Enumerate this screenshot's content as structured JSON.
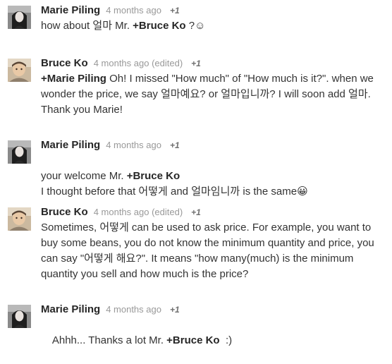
{
  "comments": [
    {
      "author": "Marie Piling",
      "time": "4 months ago",
      "plus": "+1",
      "segments": [
        {
          "text": "how about 얼마 Mr. "
        },
        {
          "text": "+Bruce Ko",
          "mention": true
        },
        {
          "text": " ?☺"
        }
      ]
    },
    {
      "author": "Bruce Ko",
      "time": "4 months ago (edited)",
      "plus": "+1",
      "segments": [
        {
          "text": "+Marie Piling",
          "mention": true
        },
        {
          "text": " Oh! I missed \"How much\" of \"How much is it?\". when we wonder the price, we say 얼마예요? or 얼마입니까? I will soon add 얼마. Thank you Marie!"
        }
      ]
    },
    {
      "author": "Marie Piling",
      "time": "4 months ago",
      "plus": "+1",
      "segments": [
        {
          "text": "your welcome Mr. "
        },
        {
          "text": "+Bruce Ko",
          "mention": true
        },
        {
          "text": "\nI thought before that 어떻게 and 얼마임니까 is the same😀"
        }
      ]
    },
    {
      "author": "Bruce Ko",
      "time": "4 months ago (edited)",
      "plus": "+1",
      "segments": [
        {
          "text": "Sometimes, 어떻게 can be used to ask price. For example, you want to buy some beans, you do not know the minimum quantity and price, you can say \"어떻게 해요?\". It means \"how many(much) is the minimum quantity you sell and how much is the price?"
        }
      ]
    },
    {
      "author": "Marie Piling",
      "time": "4 months ago",
      "plus": "+1",
      "segments": [
        {
          "text": "Ahhh... Thanks a lot Mr. "
        },
        {
          "text": "+Bruce Ko",
          "mention": true
        },
        {
          "text": "  :)"
        }
      ]
    }
  ]
}
